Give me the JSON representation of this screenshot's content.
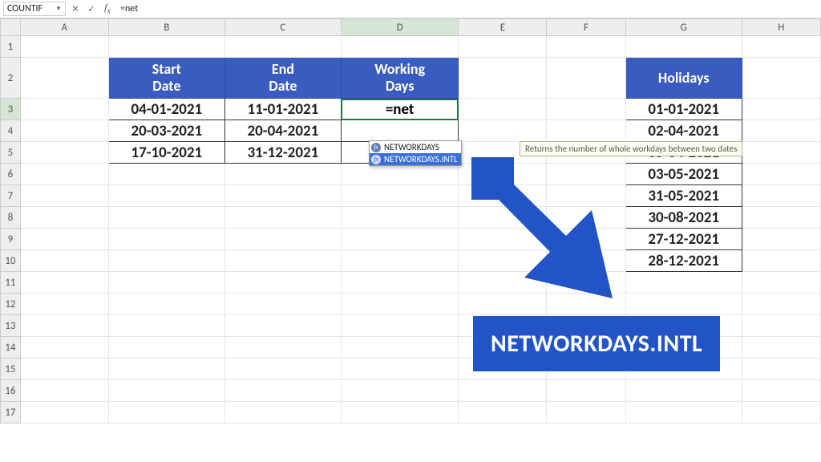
{
  "colors": {
    "accent": "#3a5bbf",
    "banner": "#2354c7",
    "selection": "#217346"
  },
  "namebox": "COUNTIF",
  "formula_bar": "=net",
  "columns": [
    "A",
    "B",
    "C",
    "D",
    "E",
    "F",
    "G",
    "H"
  ],
  "active_col": "D",
  "active_row": "3",
  "row_count": 17,
  "table1": {
    "headers": {
      "start": "Start\nDate",
      "end": "End\nDate",
      "work": "Working\nDays"
    },
    "rows": [
      {
        "start": "04-01-2021",
        "end": "11-01-2021",
        "work": "=net"
      },
      {
        "start": "20-03-2021",
        "end": "20-04-2021",
        "work": ""
      },
      {
        "start": "17-10-2021",
        "end": "31-12-2021",
        "work": ""
      }
    ]
  },
  "holidays": {
    "header": "Holidays",
    "rows": [
      "01-01-2021",
      "02-04-2021",
      "05-04-2021",
      "03-05-2021",
      "31-05-2021",
      "30-08-2021",
      "27-12-2021",
      "28-12-2021"
    ]
  },
  "autocomplete": {
    "items": [
      {
        "label": "NETWORKDAYS",
        "selected": false
      },
      {
        "label": "NETWORKDAYS.INTL",
        "selected": true
      }
    ]
  },
  "tooltip": "Returns the number of whole workdays between two dates",
  "banner": "NETWORKDAYS.INTL"
}
